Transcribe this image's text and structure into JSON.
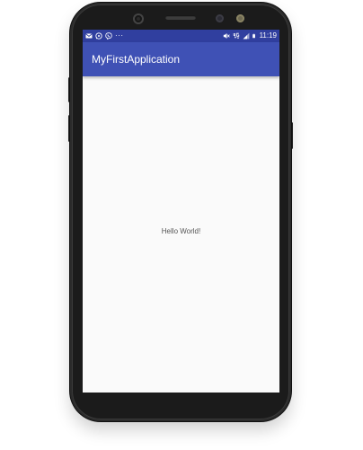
{
  "status_bar": {
    "left_icons": [
      "email-icon",
      "whatsapp-icon",
      "viber-icon"
    ],
    "more": "···",
    "right_icons": [
      "mute-icon",
      "4g-icon",
      "signal-icon",
      "battery-icon"
    ],
    "time": "11:19",
    "color": "#303f9f"
  },
  "app_bar": {
    "title": "MyFirstApplication",
    "color": "#3f51b5"
  },
  "content": {
    "text": "Hello World!"
  }
}
